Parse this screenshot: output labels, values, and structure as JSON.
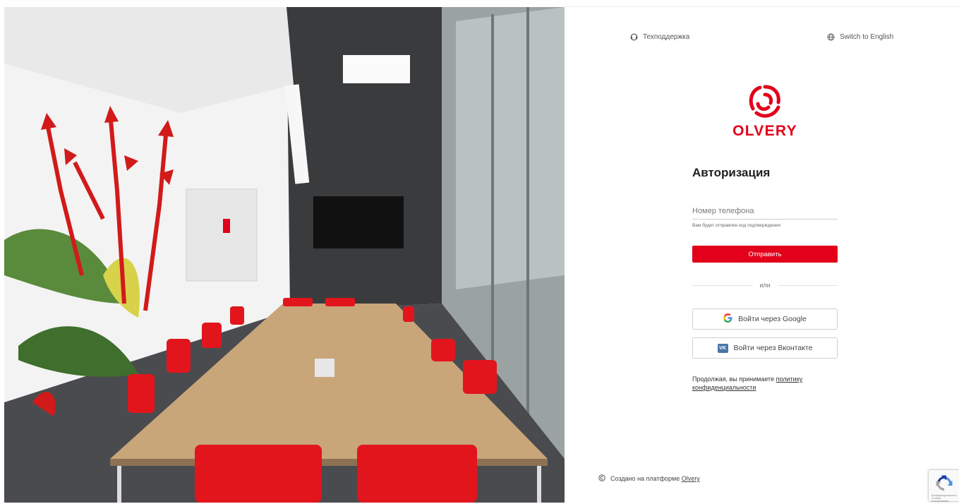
{
  "topbar": {
    "support_label": "Техподдержка",
    "language_label": "Switch to English"
  },
  "brand": {
    "name": "OLVERY",
    "color": "#e2001a"
  },
  "auth": {
    "title": "Авторизация",
    "phone_placeholder": "Номер телефона",
    "phone_value": "",
    "hint": "Вам будет отправлен код подтверждения",
    "send_label": "Отправить",
    "or_label": "или",
    "google_label": "Войти через Google",
    "vk_label": "Войти через Вконтакте",
    "vk_badge": "VK"
  },
  "consent": {
    "text": "Продолжая, вы принимаете ",
    "link_label": "политику конфиденциальности"
  },
  "footer": {
    "text": "Создано на платформе ",
    "link_label": "Olvery"
  },
  "recaptcha": {
    "label": "Конфиденциальность - Условия использования"
  },
  "icons": {
    "support": "headset-icon",
    "language": "globe-icon",
    "google": "google-icon",
    "vk": "vk-icon",
    "footer": "copyright-icon",
    "recaptcha": "recaptcha-icon"
  }
}
